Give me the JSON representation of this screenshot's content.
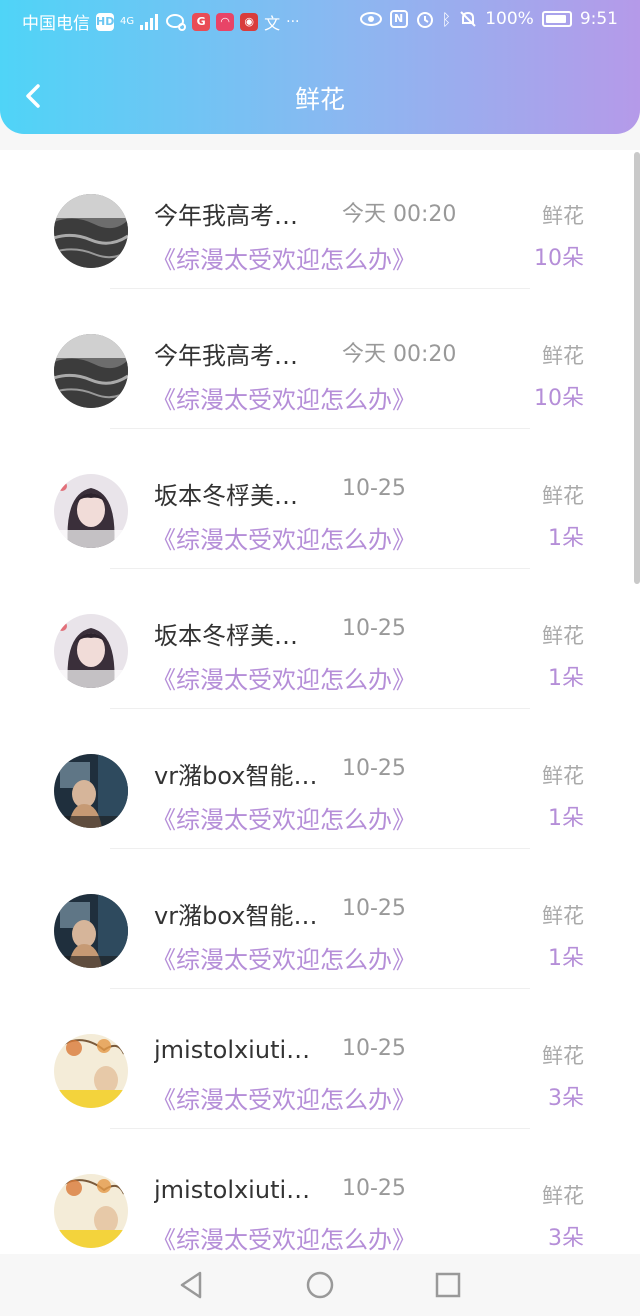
{
  "status_bar": {
    "carrier": "中国电信",
    "network": "4G",
    "battery": "100%",
    "time": "9:51"
  },
  "header": {
    "title": "鲜花"
  },
  "items": [
    {
      "name": "今年我高考…",
      "time": "今天 00:20",
      "subtitle": "《综漫太受欢迎怎么办》",
      "label": "鲜花",
      "count": "10朵",
      "avatar": "sea"
    },
    {
      "name": "今年我高考…",
      "time": "今天 00:20",
      "subtitle": "《综漫太受欢迎怎么办》",
      "label": "鲜花",
      "count": "10朵",
      "avatar": "sea"
    },
    {
      "name": "坂本冬桴美…",
      "time": "10-25",
      "subtitle": "《综漫太受欢迎怎么办》",
      "label": "鲜花",
      "count": "1朵",
      "avatar": "girl"
    },
    {
      "name": "坂本冬桴美…",
      "time": "10-25",
      "subtitle": "《综漫太受欢迎怎么办》",
      "label": "鲜花",
      "count": "1朵",
      "avatar": "girl"
    },
    {
      "name": "vr潴box智能…",
      "time": "10-25",
      "subtitle": "《综漫太受欢迎怎么办》",
      "label": "鲜花",
      "count": "1朵",
      "avatar": "room"
    },
    {
      "name": "vr潴box智能…",
      "time": "10-25",
      "subtitle": "《综漫太受欢迎怎么办》",
      "label": "鲜花",
      "count": "1朵",
      "avatar": "room"
    },
    {
      "name": "jmistolxiutio…",
      "time": "10-25",
      "subtitle": "《综漫太受欢迎怎么办》",
      "label": "鲜花",
      "count": "3朵",
      "avatar": "tree"
    },
    {
      "name": "jmistolxiutio…",
      "time": "10-25",
      "subtitle": "《综漫太受欢迎怎么办》",
      "label": "鲜花",
      "count": "3朵",
      "avatar": "tree"
    }
  ],
  "colors": {
    "accent": "#b58ed8",
    "header_start": "#4fd4f7",
    "header_end": "#b59ae9"
  }
}
